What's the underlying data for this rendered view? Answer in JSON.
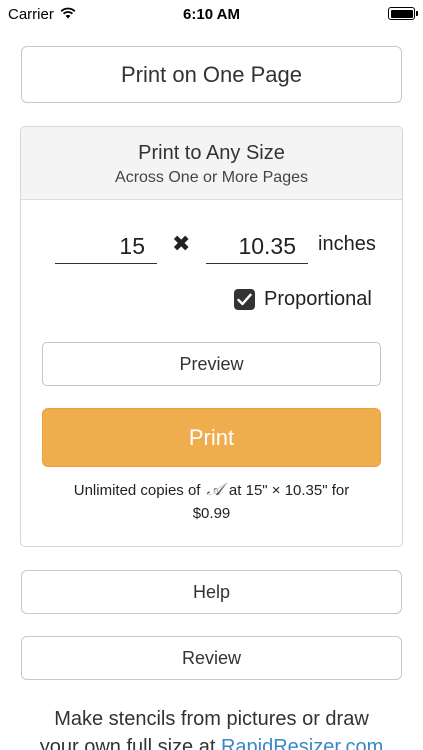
{
  "status_bar": {
    "carrier": "Carrier",
    "time": "6:10 AM",
    "battery_level": 1.0
  },
  "print_one_page_label": "Print on One Page",
  "any_size_panel": {
    "title": "Print to Any Size",
    "subtitle": "Across One or More Pages",
    "width_value": "15",
    "times_symbol": "✖",
    "height_value": "10.35",
    "unit": "inches",
    "proportional_label": "Proportional",
    "proportional_checked": true,
    "preview_label": "Preview",
    "print_label": "Print",
    "note_prefix": "Unlimited copies of",
    "note_logo": "𝒜",
    "note_suffix": "at 15\" × 10.35\" for",
    "note_price": "$0.99"
  },
  "help_label": "Help",
  "review_label": "Review",
  "footer": {
    "line1": "Make stencils from pictures or draw",
    "line2_prefix": "your own full size at ",
    "line2_link": "RapidResizer.com"
  },
  "colors": {
    "print_button": "#f0ad4e",
    "link": "#3a86c8"
  },
  "icons": [
    "wifi-icon",
    "battery-icon",
    "checkmark-icon"
  ]
}
